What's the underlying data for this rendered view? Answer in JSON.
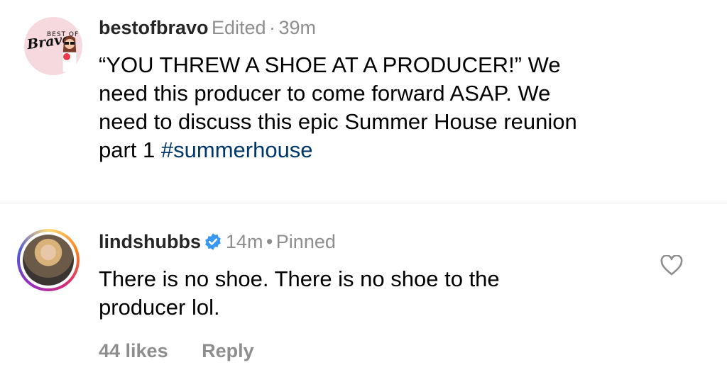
{
  "comments": [
    {
      "username": "bestofbravo",
      "edited": "Edited",
      "separator": "·",
      "time": "39m",
      "avatar_text": "BEST OF",
      "avatar_logo": "Bravo",
      "lines": [
        "“YOU THREW A SHOE AT A PRODUCER!” We",
        "need this producer to come forward ASAP. We",
        "need to discuss this epic Summer House reunion"
      ],
      "last_line_prefix": "part 1 ",
      "hashtag": "#summerhouse"
    },
    {
      "username": "lindshubbs",
      "time": "14m",
      "separator": "•",
      "pinned": "Pinned",
      "lines": [
        "There is no shoe. There is no shoe to the",
        "producer lol."
      ],
      "likes": "44 likes",
      "reply": "Reply"
    }
  ],
  "colors": {
    "verified": "#3897f0",
    "hashtag": "#00376b",
    "meta": "#8e8e8e"
  }
}
